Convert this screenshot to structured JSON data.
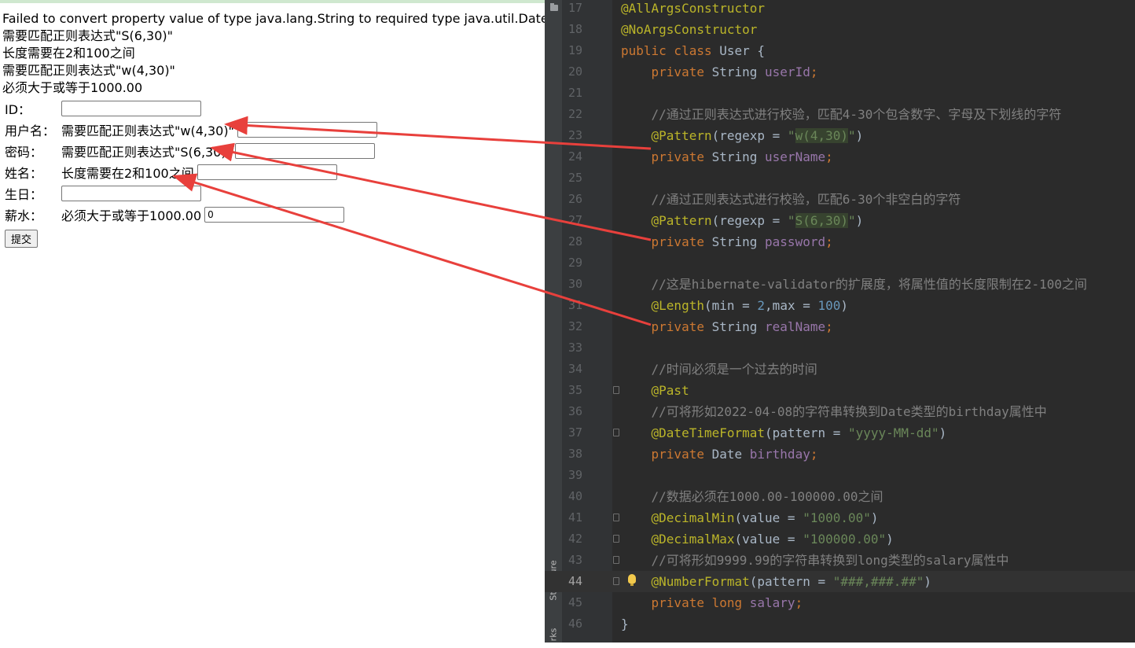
{
  "browser": {
    "errors": [
      "Failed to convert property value of type java.lang.String to required type java.util.Date",
      "需要匹配正则表达式\"S(6,30)\"",
      "长度需要在2和100之间",
      "需要匹配正则表达式\"w(4,30)\"",
      "必须大于或等于1000.00"
    ],
    "form": {
      "id": {
        "label": "ID：",
        "value": ""
      },
      "username": {
        "label": "用户名：",
        "error": "需要匹配正则表达式\"w(4,30)\"",
        "value": ""
      },
      "password": {
        "label": "密码：",
        "error": "需要匹配正则表达式\"S(6,30)\"",
        "value": ""
      },
      "realname": {
        "label": "姓名：",
        "error": "长度需要在2和100之间",
        "value": ""
      },
      "birthday": {
        "label": "生日：",
        "value": ""
      },
      "salary": {
        "label": "薪水：",
        "error": "必须大于或等于1000.00",
        "value": "0"
      },
      "submit_label": "提交"
    }
  },
  "ide": {
    "tool_windows": [
      "Structure",
      "rks"
    ],
    "current_line": 44,
    "code_lines": [
      {
        "n": "17",
        "tokens": [
          {
            "t": "@AllArgsConstructor",
            "c": "ann"
          }
        ]
      },
      {
        "n": "18",
        "tokens": [
          {
            "t": "@NoArgsConstructor",
            "c": "ann"
          }
        ]
      },
      {
        "n": "19",
        "tokens": [
          {
            "t": "public class ",
            "c": "kw"
          },
          {
            "t": "User {",
            "c": ""
          }
        ]
      },
      {
        "n": "20",
        "tokens": [
          {
            "t": "    private ",
            "c": "kw"
          },
          {
            "t": "String ",
            "c": ""
          },
          {
            "t": "userId",
            "c": "fld"
          },
          {
            "t": ";",
            "c": "kw"
          }
        ]
      },
      {
        "n": "21",
        "tokens": []
      },
      {
        "n": "22",
        "tokens": [
          {
            "t": "    //通过正则表达式进行校验，匹配4-30个包含数字、字母及下划线的字符",
            "c": "cmt"
          }
        ]
      },
      {
        "n": "23",
        "tokens": [
          {
            "t": "    @Pattern",
            "c": "ann"
          },
          {
            "t": "(regexp = ",
            "c": ""
          },
          {
            "t": "\"",
            "c": "str"
          },
          {
            "t": "w(4,30)",
            "c": "str rx"
          },
          {
            "t": "\"",
            "c": "str"
          },
          {
            "t": ")",
            "c": ""
          }
        ]
      },
      {
        "n": "24",
        "tokens": [
          {
            "t": "    private ",
            "c": "kw"
          },
          {
            "t": "String ",
            "c": ""
          },
          {
            "t": "userName",
            "c": "fld"
          },
          {
            "t": ";",
            "c": "kw"
          }
        ]
      },
      {
        "n": "25",
        "tokens": []
      },
      {
        "n": "26",
        "tokens": [
          {
            "t": "    //通过正则表达式进行校验，匹配6-30个非空白的字符",
            "c": "cmt"
          }
        ]
      },
      {
        "n": "27",
        "tokens": [
          {
            "t": "    @Pattern",
            "c": "ann"
          },
          {
            "t": "(regexp = ",
            "c": ""
          },
          {
            "t": "\"",
            "c": "str"
          },
          {
            "t": "S(6,30)",
            "c": "str rx"
          },
          {
            "t": "\"",
            "c": "str"
          },
          {
            "t": ")",
            "c": ""
          }
        ]
      },
      {
        "n": "28",
        "tokens": [
          {
            "t": "    private ",
            "c": "kw"
          },
          {
            "t": "String ",
            "c": ""
          },
          {
            "t": "password",
            "c": "fld"
          },
          {
            "t": ";",
            "c": "kw"
          }
        ]
      },
      {
        "n": "29",
        "tokens": []
      },
      {
        "n": "30",
        "tokens": [
          {
            "t": "    //这是hibernate-validator的扩展度，将属性值的长度限制在2-100之间",
            "c": "cmt"
          }
        ]
      },
      {
        "n": "31",
        "tokens": [
          {
            "t": "    @Length",
            "c": "ann"
          },
          {
            "t": "(min = ",
            "c": ""
          },
          {
            "t": "2",
            "c": "num"
          },
          {
            "t": ",max = ",
            "c": ""
          },
          {
            "t": "100",
            "c": "num"
          },
          {
            "t": ")",
            "c": ""
          }
        ]
      },
      {
        "n": "32",
        "tokens": [
          {
            "t": "    private ",
            "c": "kw"
          },
          {
            "t": "String ",
            "c": ""
          },
          {
            "t": "realName",
            "c": "fld"
          },
          {
            "t": ";",
            "c": "kw"
          }
        ]
      },
      {
        "n": "33",
        "tokens": []
      },
      {
        "n": "34",
        "tokens": [
          {
            "t": "    //时间必须是一个过去的时间",
            "c": "cmt"
          }
        ]
      },
      {
        "n": "35",
        "tokens": [
          {
            "t": "    @Past",
            "c": "ann"
          }
        ]
      },
      {
        "n": "36",
        "tokens": [
          {
            "t": "    //可将形如2022-04-08的字符串转换到Date类型的birthday属性中",
            "c": "cmt"
          }
        ]
      },
      {
        "n": "37",
        "tokens": [
          {
            "t": "    @DateTimeFormat",
            "c": "ann"
          },
          {
            "t": "(pattern = ",
            "c": ""
          },
          {
            "t": "\"yyyy-MM-dd\"",
            "c": "str"
          },
          {
            "t": ")",
            "c": ""
          }
        ]
      },
      {
        "n": "38",
        "tokens": [
          {
            "t": "    private ",
            "c": "kw"
          },
          {
            "t": "Date ",
            "c": ""
          },
          {
            "t": "birthday",
            "c": "fld"
          },
          {
            "t": ";",
            "c": "kw"
          }
        ]
      },
      {
        "n": "39",
        "tokens": []
      },
      {
        "n": "40",
        "tokens": [
          {
            "t": "    //数据必须在1000.00-100000.00之间",
            "c": "cmt"
          }
        ]
      },
      {
        "n": "41",
        "tokens": [
          {
            "t": "    @DecimalMin",
            "c": "ann"
          },
          {
            "t": "(value = ",
            "c": ""
          },
          {
            "t": "\"1000.00\"",
            "c": "str"
          },
          {
            "t": ")",
            "c": ""
          }
        ]
      },
      {
        "n": "42",
        "tokens": [
          {
            "t": "    @DecimalMax",
            "c": "ann"
          },
          {
            "t": "(value = ",
            "c": ""
          },
          {
            "t": "\"100000.00\"",
            "c": "str"
          },
          {
            "t": ")",
            "c": ""
          }
        ]
      },
      {
        "n": "43",
        "tokens": [
          {
            "t": "    //可将形如9999.99的字符串转换到long类型的salary属性中",
            "c": "cmt"
          }
        ]
      },
      {
        "n": "44",
        "tokens": [
          {
            "t": "    @NumberFormat",
            "c": "ann"
          },
          {
            "t": "(pattern = ",
            "c": ""
          },
          {
            "t": "\"###,###.##\"",
            "c": "str"
          },
          {
            "t": ")",
            "c": ""
          }
        ]
      },
      {
        "n": "45",
        "tokens": [
          {
            "t": "    private long ",
            "c": "kw"
          },
          {
            "t": "salary",
            "c": "fld"
          },
          {
            "t": ";",
            "c": "kw"
          }
        ]
      },
      {
        "n": "46",
        "tokens": [
          {
            "t": "}",
            "c": ""
          }
        ]
      }
    ]
  },
  "colors": {
    "ide_background": "#2b2b2b",
    "annotation": "#bbb529",
    "keyword": "#cc7832",
    "field": "#9876aa",
    "string": "#6a8759",
    "number": "#6897bb",
    "comment": "#808080",
    "arrow": "#e8403c"
  }
}
